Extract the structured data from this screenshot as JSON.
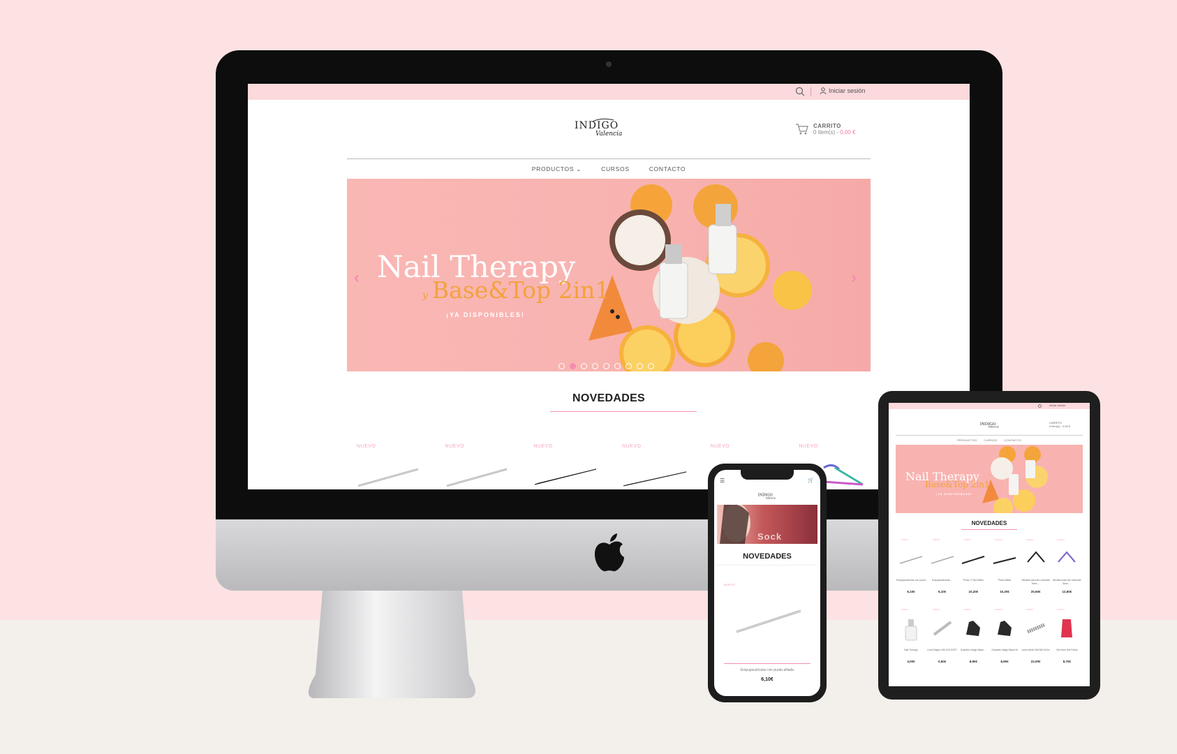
{
  "colors": {
    "accent_pink": "#f58db1",
    "topbar_pink": "#fbd9dc",
    "backdrop": "#fde2e3"
  },
  "desktop": {
    "login": "Iniciar sesión",
    "cart": {
      "title": "CARRITO",
      "items": "0 item(s) -",
      "total": "0,00 €"
    },
    "nav": [
      "PRODUCTOS",
      "CURSOS",
      "CONTACTO"
    ],
    "banner": {
      "title": "Nail Therapy",
      "y": "y",
      "subtitle": "Base&Top 2in1",
      "tagline": "¡YA DISPONIBLES!",
      "slides": 9,
      "active_slide": 2
    },
    "section_title": "NOVEDADES",
    "badge": "NUEVO",
    "products": [
      {
        "badge": "NUEVO",
        "icon": "pusher-icon"
      },
      {
        "badge": "NUEVO",
        "icon": "pusher-icon"
      },
      {
        "badge": "NUEVO",
        "icon": "tweezers-icon"
      },
      {
        "badge": "NUEVO",
        "icon": "tweezers-icon"
      },
      {
        "badge": "NUEVO",
        "icon": "nipper-icon"
      },
      {
        "badge": "NUEVO",
        "icon": "nipper-icon"
      }
    ]
  },
  "tablet": {
    "login": "Iniciar sesión",
    "cart": {
      "title": "CARRITO",
      "items": "0 item(s) - 0,00 €"
    },
    "nav": [
      "PRODUCTOS",
      "CURSOS",
      "CONTACTO"
    ],
    "banner": {
      "title": "Nail Therapy",
      "subtitle": "Base&Top 2in1",
      "tagline": "¡YA DISPONIBLES!"
    },
    "section_title": "NOVEDADES",
    "products": [
      {
        "badge": "NUEVO",
        "name": "Empujacutículas con punta ...",
        "price": "6,10€"
      },
      {
        "badge": "NUEVO",
        "name": "Empujacutículas ...",
        "price": "6,10€"
      },
      {
        "badge": "NUEVO",
        "name": "Pinza X Tipo Black",
        "price": "10,20€"
      },
      {
        "badge": "NUEVO",
        "name": "Pinza Black",
        "price": "10,20€"
      },
      {
        "badge": "NUEVO",
        "name": "Alicates para las cutículas 5mm ...",
        "price": "20,50€"
      },
      {
        "badge": "NUEVO",
        "name": "Alicates para las cutículas 5mm ...",
        "price": "12,50€"
      },
      {
        "badge": "NUEVO",
        "name": "Nail Therapy",
        "price": "4,00€"
      },
      {
        "badge": "NUEVO",
        "name": "Lima Edges 180-240 SOFT",
        "price": "0,50€"
      },
      {
        "badge": "NUEVO",
        "name": "Guantes Indigo Black ...",
        "price": "8,90€"
      },
      {
        "badge": "NUEVO",
        "name": "Guantes Indigo Black M",
        "price": "8,90€"
      },
      {
        "badge": "NUEVO",
        "name": "Lima Infinit 100/180 5x2m",
        "price": "22,00€"
      },
      {
        "badge": "NUEVO",
        "name": "Gel Nem Gel Polish",
        "price": "8,70€"
      }
    ]
  },
  "phone": {
    "banner_text": "Sock",
    "section_title": "NOVEDADES",
    "product": {
      "badge": "NUEVO",
      "name": "Empujacutículas con punta afilada",
      "price": "6,10€"
    }
  }
}
